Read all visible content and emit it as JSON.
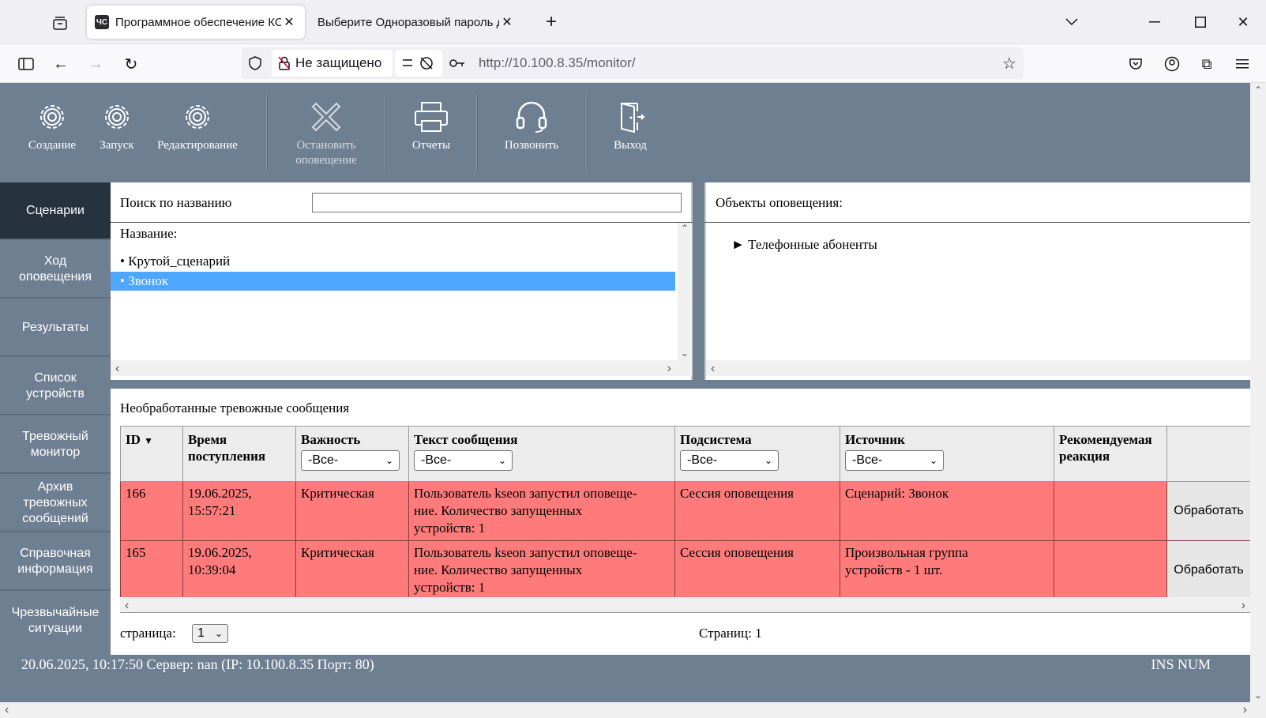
{
  "browser": {
    "tabs": [
      {
        "favicon": "ЧС",
        "title": "Программное обеспечение КС"
      },
      {
        "title": "Выберите Одноразовый пароль для"
      }
    ],
    "security_label": "Не защищено",
    "url": "http://10.100.8.35/monitor/"
  },
  "toolbar": {
    "create": "Создание",
    "launch": "Запуск",
    "edit": "Редактирование",
    "stop_line1": "Остановить",
    "stop_line2": "оповещение",
    "reports": "Отчеты",
    "call": "Позвонить",
    "exit": "Выход"
  },
  "sidebar": {
    "items": [
      {
        "line1": "Сценарии",
        "line2": ""
      },
      {
        "line1": "Ход",
        "line2": "оповещения"
      },
      {
        "line1": "Результаты",
        "line2": ""
      },
      {
        "line1": "Список",
        "line2": "устройств"
      },
      {
        "line1": "Тревожный",
        "line2": "монитор"
      },
      {
        "line1": "Архив",
        "line2": "тревожных",
        "line3": "сообщений"
      },
      {
        "line1": "Справочная",
        "line2": "информация"
      },
      {
        "line1": "Чрезвычайные",
        "line2": "ситуации"
      }
    ]
  },
  "scenarios": {
    "search_label": "Поиск по названию",
    "search_value": "",
    "name_header": "Название:",
    "items": [
      "• Крутой_сценарий",
      "• Звонок"
    ]
  },
  "objects": {
    "title": "Объекты оповещения:",
    "tree": [
      "► Телефонные абоненты"
    ]
  },
  "alarms": {
    "title": "Необработанные тревожные сообщения",
    "columns": {
      "id": "ID",
      "sort_glyph": "▼",
      "time_line1": "Время",
      "time_line2": "поступления",
      "severity": "Важность",
      "text": "Текст сообщения",
      "subsystem": "Подсистема",
      "source": "Источник",
      "reaction_line1": "Рекомендуемая",
      "reaction_line2": "реакция"
    },
    "filter_all": "-Все-",
    "rows": [
      {
        "id": "166",
        "time_line1": "19.06.2025,",
        "time_line2": "15:57:21",
        "severity": "Критическая",
        "text_line1": "Пользователь kseon запустил оповеще-",
        "text_line2": "ние. Количество запущенных",
        "text_line3": "устройств: 1",
        "subsystem": "Сессия оповещения",
        "source_line1": "Сценарий: Звонок",
        "source_line2": "",
        "reaction": "",
        "action": "Обработать"
      },
      {
        "id": "165",
        "time_line1": "19.06.2025,",
        "time_line2": "10:39:04",
        "severity": "Критическая",
        "text_line1": "Пользователь kseon запустил оповеще-",
        "text_line2": "ние. Количество запущенных",
        "text_line3": "устройств: 1",
        "subsystem": "Сессия оповещения",
        "source_line1": "Произвольная группа",
        "source_line2": "устройств - 1 шт.",
        "reaction": "",
        "action": "Обработать"
      }
    ],
    "page_label": "страница:",
    "page_value": "1",
    "pages_label": "Страниц: 1"
  },
  "statusbar": {
    "left": "20.06.2025, 10:17:50 Сервер: nan (IP: 10.100.8.35 Порт: 80)",
    "right": "INS NUM"
  }
}
